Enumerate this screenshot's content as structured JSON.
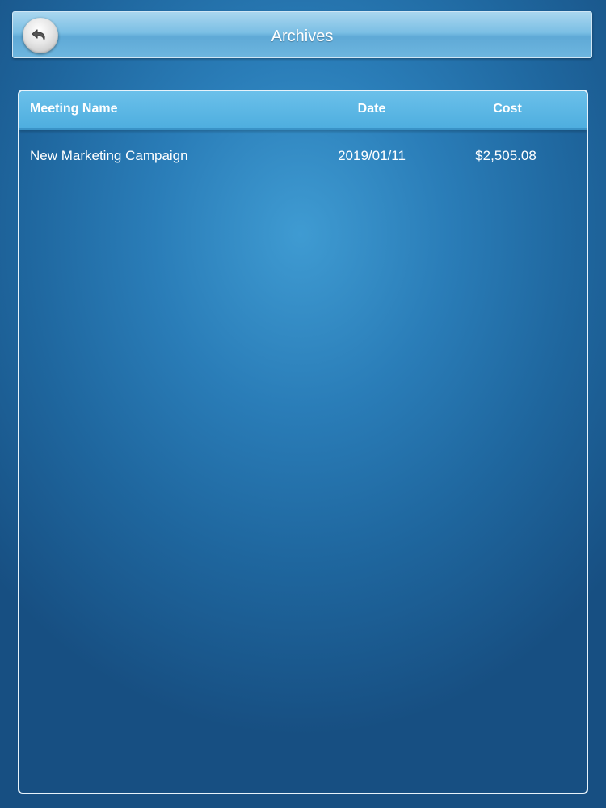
{
  "header": {
    "title": "Archives",
    "back_icon": "back-arrow-icon"
  },
  "table": {
    "columns": [
      "Meeting Name",
      "Date",
      "Cost"
    ],
    "rows": [
      {
        "name": "New Marketing Campaign",
        "date": "2019/01/11",
        "cost": "$2,505.08"
      }
    ]
  },
  "colors": {
    "background": "#2a7db8",
    "header_bar": "#7bbfe4",
    "table_header": "#4eaedf",
    "text": "#ffffff"
  }
}
